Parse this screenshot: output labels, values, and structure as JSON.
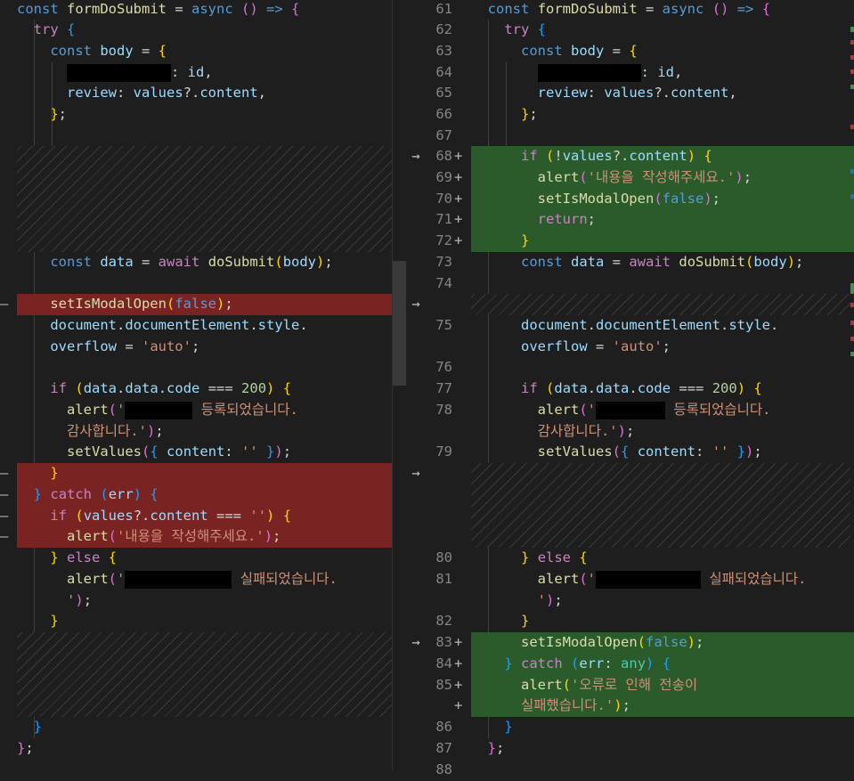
{
  "code": {
    "const": "const",
    "async": "async",
    "try": "try",
    "await": "await",
    "if": "if",
    "else": "else",
    "catch": "catch",
    "return": "return",
    "false": "false",
    "any": "any",
    "formDoSubmit": "formDoSubmit",
    "body": "body",
    "data": "data",
    "doSubmit": "doSubmit",
    "values": "values",
    "content": "content",
    "id": "id",
    "review": "review",
    "code": "code",
    "err": "err",
    "document": "document",
    "documentElement": "documentElement",
    "style": "style",
    "overflow": "overflow",
    "alert": "alert",
    "setIsModalOpen": "setIsModalOpen",
    "setValues": "setValues",
    "num200": "200",
    "str_auto": "'auto'",
    "str_empty": "''",
    "str_quote": "'",
    "str_enter": "'내용을 작성해주세요.'",
    "str_registered": "등록되었습니다.",
    "str_thanks": "감사합니다.'",
    "str_failed": "실패되었습니다.",
    "str_close": "'",
    "str_error1": "'오류로 인해 전송이",
    "str_error2": "실패했습니다.'"
  },
  "gutter": {
    "right_line_numbers": [
      "61",
      "62",
      "63",
      "64",
      "65",
      "66",
      "67",
      "68",
      "69",
      "70",
      "71",
      "72",
      "73",
      "74",
      "75",
      "76",
      "77",
      "78",
      "79",
      "80",
      "81",
      "82",
      "83",
      "84",
      "85",
      "86",
      "87",
      "88"
    ],
    "add_marker": "+",
    "del_marker": "—",
    "arrow": "→"
  },
  "colors": {
    "background": "#1e1e1e",
    "deleted_line": "#792323",
    "added_line": "#2b5a2b",
    "keyword": "#569cd6",
    "control": "#c586c0",
    "function": "#dcdcaa",
    "variable": "#9cdcfe",
    "string": "#ce9178"
  }
}
